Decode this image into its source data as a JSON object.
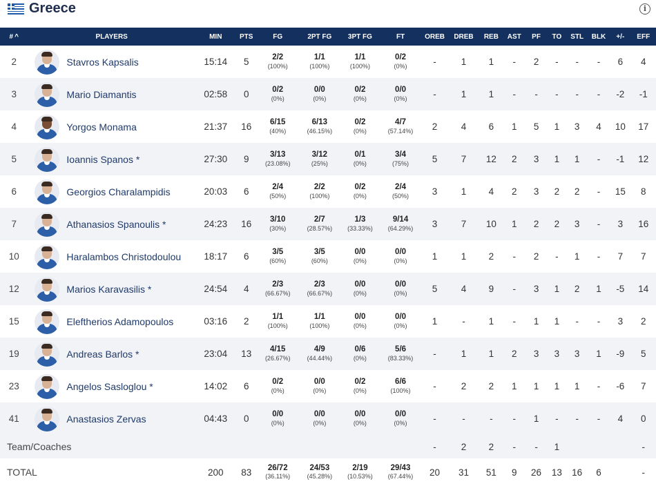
{
  "team": {
    "name": "Greece",
    "flag_icon": "greece-flag-icon",
    "info_icon": "info-icon",
    "info_glyph": "i"
  },
  "columns": [
    "#",
    "PLAYERS",
    "MIN",
    "PTS",
    "FG",
    "2PT FG",
    "3PT FG",
    "FT",
    "OREB",
    "DREB",
    "REB",
    "AST",
    "PF",
    "TO",
    "STL",
    "BLK",
    "+/-",
    "EFF"
  ],
  "sort_indicator": "^",
  "players": [
    {
      "num": "2",
      "name": "Stavros Kapsalis",
      "min": "15:14",
      "pts": "5",
      "fg": "2/2",
      "fg_pct": "(100%)",
      "fg2": "1/1",
      "fg2_pct": "(100%)",
      "fg3": "1/1",
      "fg3_pct": "(100%)",
      "ft": "0/2",
      "ft_pct": "(0%)",
      "oreb": "-",
      "dreb": "1",
      "reb": "1",
      "ast": "-",
      "pf": "2",
      "to": "-",
      "stl": "-",
      "blk": "-",
      "pm": "6",
      "eff": "4"
    },
    {
      "num": "3",
      "name": "Mario Diamantis",
      "min": "02:58",
      "pts": "0",
      "fg": "0/2",
      "fg_pct": "(0%)",
      "fg2": "0/0",
      "fg2_pct": "(0%)",
      "fg3": "0/2",
      "fg3_pct": "(0%)",
      "ft": "0/0",
      "ft_pct": "(0%)",
      "oreb": "-",
      "dreb": "1",
      "reb": "1",
      "ast": "-",
      "pf": "-",
      "to": "-",
      "stl": "-",
      "blk": "-",
      "pm": "-2",
      "eff": "-1"
    },
    {
      "num": "4",
      "name": "Yorgos Monama",
      "min": "21:37",
      "pts": "16",
      "fg": "6/15",
      "fg_pct": "(40%)",
      "fg2": "6/13",
      "fg2_pct": "(46.15%)",
      "fg3": "0/2",
      "fg3_pct": "(0%)",
      "ft": "4/7",
      "ft_pct": "(57.14%)",
      "oreb": "2",
      "dreb": "4",
      "reb": "6",
      "ast": "1",
      "pf": "5",
      "to": "1",
      "stl": "3",
      "blk": "4",
      "pm": "10",
      "eff": "17"
    },
    {
      "num": "5",
      "name": "Ioannis Spanos *",
      "min": "27:30",
      "pts": "9",
      "fg": "3/13",
      "fg_pct": "(23.08%)",
      "fg2": "3/12",
      "fg2_pct": "(25%)",
      "fg3": "0/1",
      "fg3_pct": "(0%)",
      "ft": "3/4",
      "ft_pct": "(75%)",
      "oreb": "5",
      "dreb": "7",
      "reb": "12",
      "ast": "2",
      "pf": "3",
      "to": "1",
      "stl": "1",
      "blk": "-",
      "pm": "-1",
      "eff": "12"
    },
    {
      "num": "6",
      "name": "Georgios Charalampidis",
      "min": "20:03",
      "pts": "6",
      "fg": "2/4",
      "fg_pct": "(50%)",
      "fg2": "2/2",
      "fg2_pct": "(100%)",
      "fg3": "0/2",
      "fg3_pct": "(0%)",
      "ft": "2/4",
      "ft_pct": "(50%)",
      "oreb": "3",
      "dreb": "1",
      "reb": "4",
      "ast": "2",
      "pf": "3",
      "to": "2",
      "stl": "2",
      "blk": "-",
      "pm": "15",
      "eff": "8"
    },
    {
      "num": "7",
      "name": "Athanasios Spanoulis *",
      "min": "24:23",
      "pts": "16",
      "fg": "3/10",
      "fg_pct": "(30%)",
      "fg2": "2/7",
      "fg2_pct": "(28.57%)",
      "fg3": "1/3",
      "fg3_pct": "(33.33%)",
      "ft": "9/14",
      "ft_pct": "(64.29%)",
      "oreb": "3",
      "dreb": "7",
      "reb": "10",
      "ast": "1",
      "pf": "2",
      "to": "2",
      "stl": "3",
      "blk": "-",
      "pm": "3",
      "eff": "16"
    },
    {
      "num": "10",
      "name": "Haralambos Christodoulou",
      "min": "18:17",
      "pts": "6",
      "fg": "3/5",
      "fg_pct": "(60%)",
      "fg2": "3/5",
      "fg2_pct": "(60%)",
      "fg3": "0/0",
      "fg3_pct": "(0%)",
      "ft": "0/0",
      "ft_pct": "(0%)",
      "oreb": "1",
      "dreb": "1",
      "reb": "2",
      "ast": "-",
      "pf": "2",
      "to": "-",
      "stl": "1",
      "blk": "-",
      "pm": "7",
      "eff": "7"
    },
    {
      "num": "12",
      "name": "Marios Karavasilis *",
      "min": "24:54",
      "pts": "4",
      "fg": "2/3",
      "fg_pct": "(66.67%)",
      "fg2": "2/3",
      "fg2_pct": "(66.67%)",
      "fg3": "0/0",
      "fg3_pct": "(0%)",
      "ft": "0/0",
      "ft_pct": "(0%)",
      "oreb": "5",
      "dreb": "4",
      "reb": "9",
      "ast": "-",
      "pf": "3",
      "to": "1",
      "stl": "2",
      "blk": "1",
      "pm": "-5",
      "eff": "14"
    },
    {
      "num": "15",
      "name": "Eleftherios Adamopoulos",
      "min": "03:16",
      "pts": "2",
      "fg": "1/1",
      "fg_pct": "(100%)",
      "fg2": "1/1",
      "fg2_pct": "(100%)",
      "fg3": "0/0",
      "fg3_pct": "(0%)",
      "ft": "0/0",
      "ft_pct": "(0%)",
      "oreb": "1",
      "dreb": "-",
      "reb": "1",
      "ast": "-",
      "pf": "1",
      "to": "1",
      "stl": "-",
      "blk": "-",
      "pm": "3",
      "eff": "2"
    },
    {
      "num": "19",
      "name": "Andreas Barlos *",
      "min": "23:04",
      "pts": "13",
      "fg": "4/15",
      "fg_pct": "(26.67%)",
      "fg2": "4/9",
      "fg2_pct": "(44.44%)",
      "fg3": "0/6",
      "fg3_pct": "(0%)",
      "ft": "5/6",
      "ft_pct": "(83.33%)",
      "oreb": "-",
      "dreb": "1",
      "reb": "1",
      "ast": "2",
      "pf": "3",
      "to": "3",
      "stl": "3",
      "blk": "1",
      "pm": "-9",
      "eff": "5"
    },
    {
      "num": "23",
      "name": "Angelos Sasloglou *",
      "min": "14:02",
      "pts": "6",
      "fg": "0/2",
      "fg_pct": "(0%)",
      "fg2": "0/0",
      "fg2_pct": "(0%)",
      "fg3": "0/2",
      "fg3_pct": "(0%)",
      "ft": "6/6",
      "ft_pct": "(100%)",
      "oreb": "-",
      "dreb": "2",
      "reb": "2",
      "ast": "1",
      "pf": "1",
      "to": "1",
      "stl": "1",
      "blk": "-",
      "pm": "-6",
      "eff": "7"
    },
    {
      "num": "41",
      "name": "Anastasios Zervas",
      "min": "04:43",
      "pts": "0",
      "fg": "0/0",
      "fg_pct": "(0%)",
      "fg2": "0/0",
      "fg2_pct": "(0%)",
      "fg3": "0/0",
      "fg3_pct": "(0%)",
      "ft": "0/0",
      "ft_pct": "(0%)",
      "oreb": "-",
      "dreb": "-",
      "reb": "-",
      "ast": "-",
      "pf": "1",
      "to": "-",
      "stl": "-",
      "blk": "-",
      "pm": "4",
      "eff": "0"
    }
  ],
  "team_coaches": {
    "label": "Team/Coaches",
    "oreb": "-",
    "dreb": "2",
    "reb": "2",
    "ast": "-",
    "pf": "-",
    "to": "1",
    "stl": "",
    "blk": "",
    "pm": "",
    "eff": "-"
  },
  "total": {
    "label": "TOTAL",
    "min": "200",
    "pts": "83",
    "fg": "26/72",
    "fg_pct": "(36.11%)",
    "fg2": "24/53",
    "fg2_pct": "(45.28%)",
    "fg3": "2/19",
    "fg3_pct": "(10.53%)",
    "ft": "29/43",
    "ft_pct": "(67.44%)",
    "oreb": "20",
    "dreb": "31",
    "reb": "51",
    "ast": "9",
    "pf": "26",
    "to": "13",
    "stl": "16",
    "blk": "6",
    "pm": "",
    "eff": "-"
  },
  "colors": {
    "header_bg": "#13305f",
    "row_alt": "#f1f3f7",
    "name_color": "#1f3a6a",
    "jersey": "#2c5fa8"
  }
}
